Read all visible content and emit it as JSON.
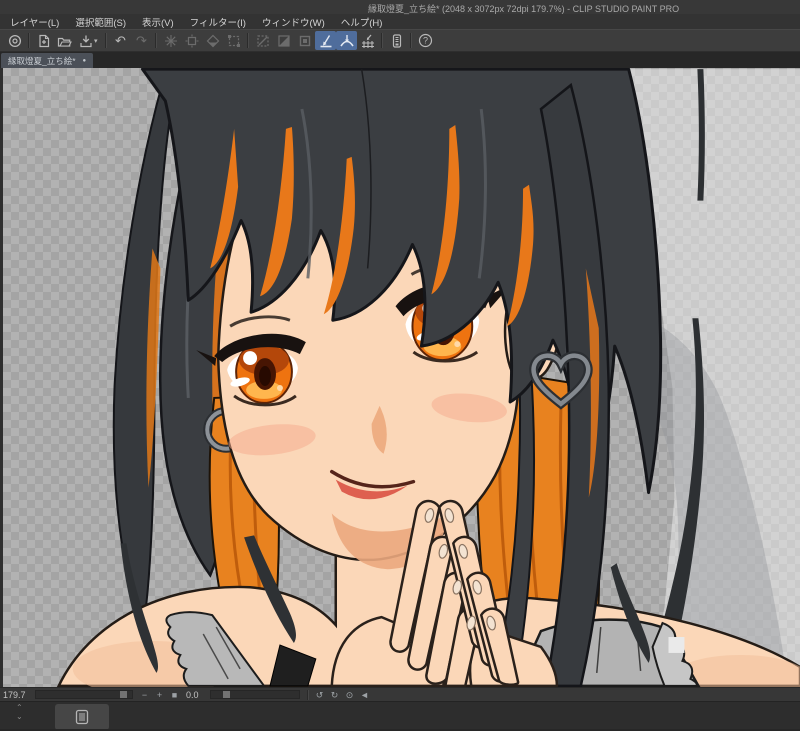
{
  "window": {
    "title": "縁取燈夏_立ち絵* (2048 x 3072px 72dpi 179.7%)  - CLIP STUDIO PAINT PRO",
    "app_name": "CLIP STUDIO PAINT PRO"
  },
  "menu": {
    "items": [
      {
        "label": "レイヤー(L)"
      },
      {
        "label": "選択範囲(S)"
      },
      {
        "label": "表示(V)"
      },
      {
        "label": "フィルター(I)"
      },
      {
        "label": "ウィンドウ(W)"
      },
      {
        "label": "ヘルプ(H)"
      }
    ]
  },
  "toolbar": {
    "icons": [
      {
        "name": "clip-studio-logo-icon",
        "state": "normal"
      },
      {
        "name": "new-file-icon",
        "state": "normal"
      },
      {
        "name": "open-file-icon",
        "state": "normal"
      },
      {
        "name": "save-icon",
        "state": "normal"
      },
      {
        "name": "undo-icon",
        "state": "normal"
      },
      {
        "name": "redo-icon",
        "state": "disabled"
      },
      {
        "name": "erase-icon",
        "state": "disabled"
      },
      {
        "name": "erase-outside-selection-icon",
        "state": "disabled"
      },
      {
        "name": "fill-icon",
        "state": "disabled"
      },
      {
        "name": "scale-rotate-icon",
        "state": "disabled"
      },
      {
        "name": "deselect-icon",
        "state": "disabled"
      },
      {
        "name": "invert-selection-icon",
        "state": "disabled"
      },
      {
        "name": "selection-border-icon",
        "state": "disabled"
      },
      {
        "name": "snap-to-ruler-icon",
        "state": "active"
      },
      {
        "name": "snap-to-special-ruler-icon",
        "state": "active"
      },
      {
        "name": "snap-to-grid-icon",
        "state": "normal"
      },
      {
        "name": "tablet-palette-icon",
        "state": "normal"
      },
      {
        "name": "help-icon",
        "state": "normal"
      }
    ],
    "undo_glyph": "↶",
    "redo_glyph": "↷",
    "save_chevron": "▾",
    "help_glyph": "?"
  },
  "tab": {
    "label": "縁取燈夏_立ち絵*",
    "dot": "●"
  },
  "statusbar": {
    "zoom_value": "179.7",
    "zoom_out": "−",
    "zoom_in": "+",
    "fit": "■",
    "rotation_value": "0.0",
    "rotate_ccw": "↺",
    "rotate_cw": "↻",
    "reset_rotation": "⊙",
    "flip_view": "◄"
  },
  "bottombar": {
    "collapse_up": "⌃",
    "collapse_down": "⌄"
  },
  "colors": {
    "ui_dark": "#333333",
    "toolbar_bg": "#3d3d3d",
    "active_tool_highlight": "#4f6d9c",
    "tab_bg": "#4b5058",
    "checker_light": "#b2b2b2",
    "checker_dark": "#a4a4a4",
    "artwork_hair_black": "#3b3e42",
    "artwork_hair_orange": "#e8781a",
    "artwork_skin": "#fbd7b8",
    "artwork_eye_orange": "#ee7310",
    "artwork_lip_red": "#d84a3c",
    "artwork_cloth_gray": "#b3b3b3"
  }
}
